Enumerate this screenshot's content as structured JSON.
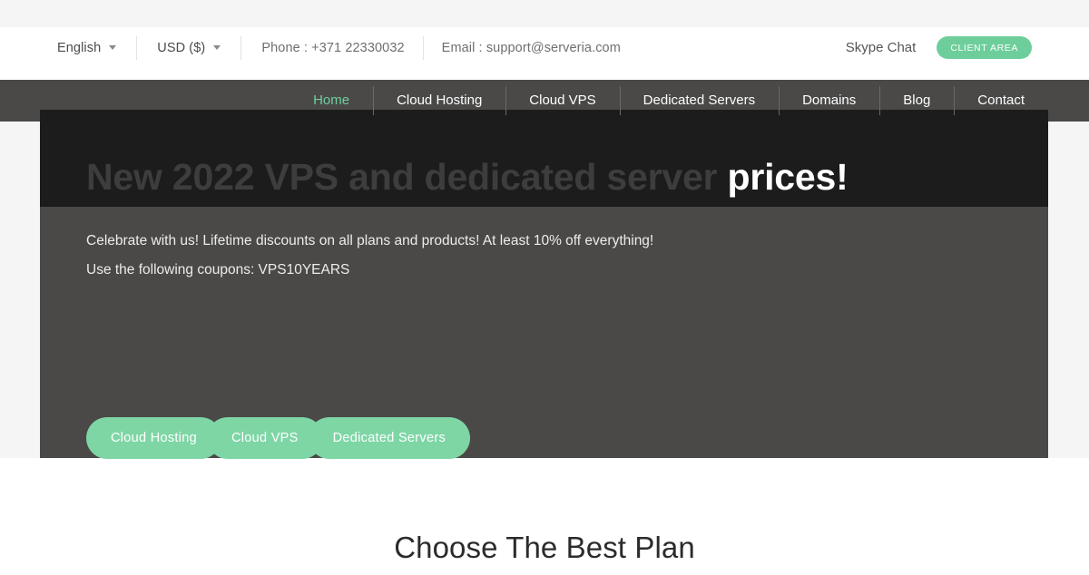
{
  "utility_bar": {
    "language": {
      "label": "English",
      "icon": "chevron-down-icon"
    },
    "currency": {
      "label": "USD ($)",
      "icon": "chevron-down-icon"
    },
    "phone": "Phone : +371 22330032",
    "email": "Email : support@serveria.com",
    "skype": "Skype Chat",
    "client_area": "CLIENT AREA"
  },
  "nav": {
    "items": [
      {
        "label": "Home",
        "active": true
      },
      {
        "label": "Cloud Hosting",
        "active": false
      },
      {
        "label": "Cloud VPS",
        "active": false
      },
      {
        "label": "Dedicated Servers",
        "active": false
      },
      {
        "label": "Domains",
        "active": false
      },
      {
        "label": "Blog",
        "active": false
      },
      {
        "label": "Contact",
        "active": false
      }
    ]
  },
  "hero": {
    "title_line1": "New 2022 VPS and dedicated server",
    "title_line2": "prices!",
    "subtitle": "Celebrate with us! Lifetime discounts on all plans and products! At least 10% off everything!",
    "coupon_line": "Use the following coupons: VPS10YEARS",
    "buttons": [
      "Cloud Hosting",
      "Cloud VPS",
      "Dedicated Servers"
    ]
  },
  "plans_section": {
    "title": "Choose The Best Plan"
  },
  "colors": {
    "accent_green": "#6ece9b",
    "button_green": "#7ed6a5",
    "hero_gray": "#4a4948",
    "hero_dark": "#1c1c1c",
    "strip_gray": "#f5f5f5"
  }
}
